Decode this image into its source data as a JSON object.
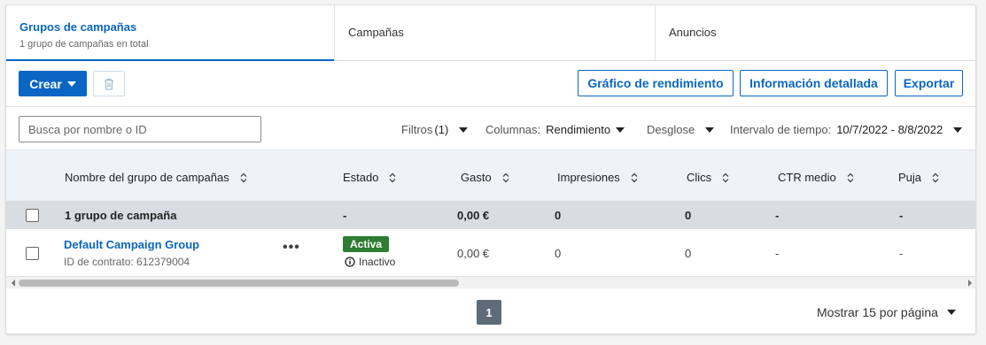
{
  "tabs": [
    {
      "label": "Grupos de campañas",
      "sub": "1 grupo de campañas en total",
      "active": true
    },
    {
      "label": "Campañas"
    },
    {
      "label": "Anuncios"
    }
  ],
  "toolbar": {
    "create_label": "Crear",
    "chart_label": "Gráfico de rendimiento",
    "details_label": "Información detallada",
    "export_label": "Exportar"
  },
  "filters": {
    "search_placeholder": "Busca por nombre o ID",
    "filters_label": "Filtros",
    "filters_count": "(1)",
    "columns_label": "Columnas:",
    "columns_value": "Rendimiento",
    "breakdown_label": "Desglose",
    "range_label": "Intervalo de tiempo:",
    "range_value": "10/7/2022 - 8/8/2022"
  },
  "table": {
    "headers": {
      "name": "Nombre del grupo de campañas",
      "status": "Estado",
      "spend": "Gasto",
      "impressions": "Impresiones",
      "clicks": "Clics",
      "ctr": "CTR medio",
      "bid": "Puja"
    },
    "summary": {
      "name": "1 grupo de campaña",
      "status": "-",
      "spend": "0,00 €",
      "impressions": "0",
      "clicks": "0",
      "ctr": "-",
      "bid": "-"
    },
    "rows": [
      {
        "name": "Default Campaign Group",
        "contract": "ID de contrato: 612379004",
        "more": "•••",
        "status_badge": "Activa",
        "status_sub": "Inactivo",
        "spend": "0,00 €",
        "impressions": "0",
        "clicks": "0",
        "ctr": "-",
        "bid": "-"
      }
    ]
  },
  "pagination": {
    "current_page": "1",
    "per_page_label": "Mostrar 15 por página"
  },
  "colors": {
    "accent": "#0a66c2",
    "active_badge": "#2e7d32",
    "header_bg": "#eef3f8",
    "summary_bg": "#d9dde2"
  }
}
